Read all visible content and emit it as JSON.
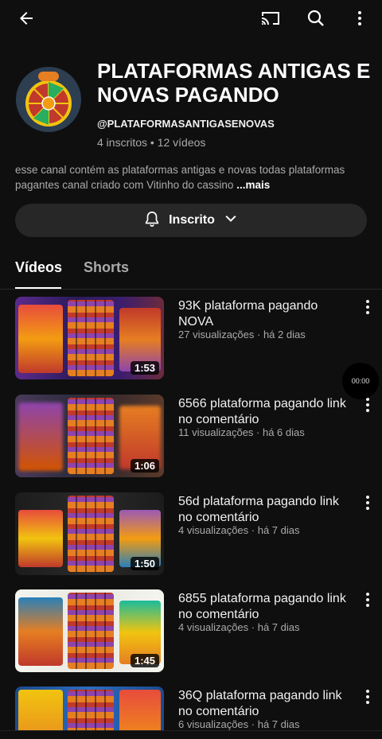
{
  "topbar": {
    "icons": [
      "back-arrow-icon",
      "cast-icon",
      "search-icon",
      "more-vert-icon"
    ]
  },
  "channel": {
    "title": "PLATAFORMAS ANTIGAS E NOVAS PAGANDO",
    "handle": "@PLATAFORMASANTIGASENOVAS",
    "stats": "4 inscritos • 12 vídeos",
    "description": "esse canal contém as plataformas   antigas e novas todas plataformas pagantes canal criado com  Vitinho do cassino ",
    "more_label": "...mais",
    "subscribe_label": "Inscrito"
  },
  "tabs": [
    {
      "label": "Vídeos",
      "active": true
    },
    {
      "label": "Shorts",
      "active": false
    }
  ],
  "videos": [
    {
      "title": "93K plataforma pagando NOVA",
      "meta": "27 visualizações · há 2 dias",
      "duration": "1:53"
    },
    {
      "title": "6566 plataforma pagando link no comentário",
      "meta": "11 visualizações · há 6 dias",
      "duration": "1:06"
    },
    {
      "title": "56d plataforma pagando link no comentário",
      "meta": "4 visualizações · há 7 dias",
      "duration": "1:50"
    },
    {
      "title": "6855 plataforma pagando link no comentário",
      "meta": "4 visualizações · há 7 dias",
      "duration": "1:45"
    },
    {
      "title": "36Q plataforma pagando link no comentário",
      "meta": "6 visualizações · há 7 dias",
      "duration": ""
    }
  ],
  "pip": {
    "time": "00:00"
  },
  "colors": {
    "background": "#0f0f0f",
    "text": "#f1f1f1",
    "secondary": "#aaaaaa",
    "chip": "#272727"
  }
}
